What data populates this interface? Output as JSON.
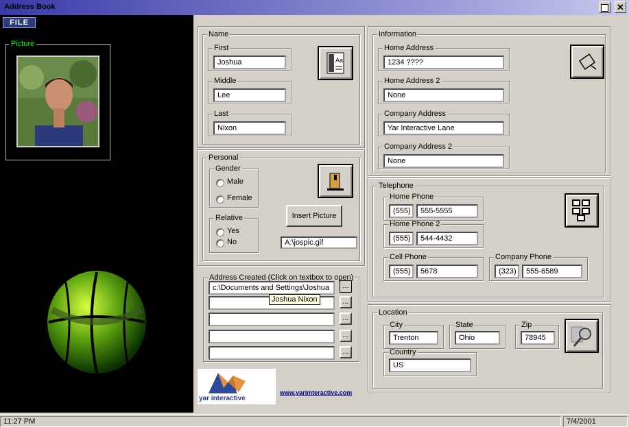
{
  "window": {
    "title": "Address Book"
  },
  "menu": {
    "file_label": "FILE"
  },
  "picture": {
    "label": "Picture"
  },
  "name": {
    "legend": "Name",
    "first_label": "First",
    "first_value": "Joshua",
    "middle_label": "Middle",
    "middle_value": "Lee",
    "last_label": "Last",
    "last_value": "Nixon"
  },
  "personal": {
    "legend": "Personal",
    "gender_label": "Gender",
    "male": "Male",
    "female": "Female",
    "relative_label": "Relative",
    "yes": "Yes",
    "no": "No",
    "insert_picture": "Insert Picture",
    "picture_path": "A:\\jospic.gif"
  },
  "address_created": {
    "legend": "Address Created (Click on textbox to open)",
    "rows": [
      "c:\\Documents and Settings\\Joshua",
      "",
      "",
      "",
      ""
    ],
    "tooltip": "Joshua Nixon",
    "browse_label": "..."
  },
  "logo": {
    "link": "www.yarimteractive.com"
  },
  "information": {
    "legend": "Information",
    "home_address_label": "Home Address",
    "home_address": "1234 ????",
    "home_address2_label": "Home Address 2",
    "home_address2": "None",
    "company_address_label": "Company Address",
    "company_address": "Yar Interactive Lane",
    "company_address2_label": "Company Address 2",
    "company_address2": "None"
  },
  "telephone": {
    "legend": "Telephone",
    "home_label": "Home Phone",
    "home_area": "(555)",
    "home_number": "555-5555",
    "home2_label": "Home Phone 2",
    "home2_area": "(555)",
    "home2_number": "544-4432",
    "cell_label": "Cell Phone",
    "cell_area": "(555)",
    "cell_number": "5678",
    "company_label": "Company Phone",
    "company_area": "(323)",
    "company_number": "555-6589"
  },
  "location": {
    "legend": "Location",
    "city_label": "City",
    "city": "Trenton",
    "state_label": "State",
    "state": "Ohio",
    "zip_label": "Zip",
    "zip": "78945",
    "country_label": "Country",
    "country": "US"
  },
  "status": {
    "time": "11:27 PM",
    "date": "7/4/2001"
  },
  "colors": {
    "accent": "#3a3aa8",
    "left_bg": "#000000",
    "picture_label": "#00ff00"
  }
}
